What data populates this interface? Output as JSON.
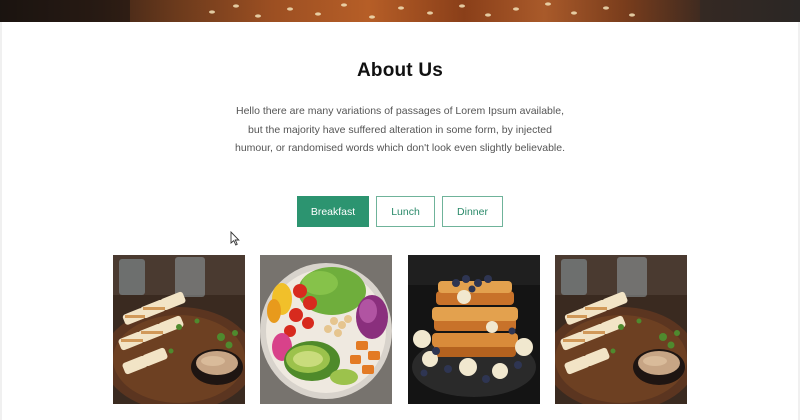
{
  "about": {
    "title": "About Us",
    "description": "Hello there are many variations of passages of Lorem Ipsum available, but the majority have suffered alteration in some form, by injected humour, or randomised words which don't look even slightly believable."
  },
  "menu_tabs": [
    {
      "label": "Breakfast",
      "active": true
    },
    {
      "label": "Lunch",
      "active": false
    },
    {
      "label": "Dinner",
      "active": false
    }
  ],
  "gallery": {
    "items": [
      {
        "image": "grilled-chicken-skewers-with-dip"
      },
      {
        "image": "salad-bowl-with-avocado-tomatoes"
      },
      {
        "image": "french-toast-with-berries-and-banana"
      },
      {
        "image": "grilled-chicken-skewers-with-dip"
      }
    ]
  },
  "colors": {
    "accent": "#2c9470",
    "tab_border": "#6fb39a",
    "tab_text": "#2b8a6a",
    "heading": "#111111",
    "body_text": "#555555"
  }
}
